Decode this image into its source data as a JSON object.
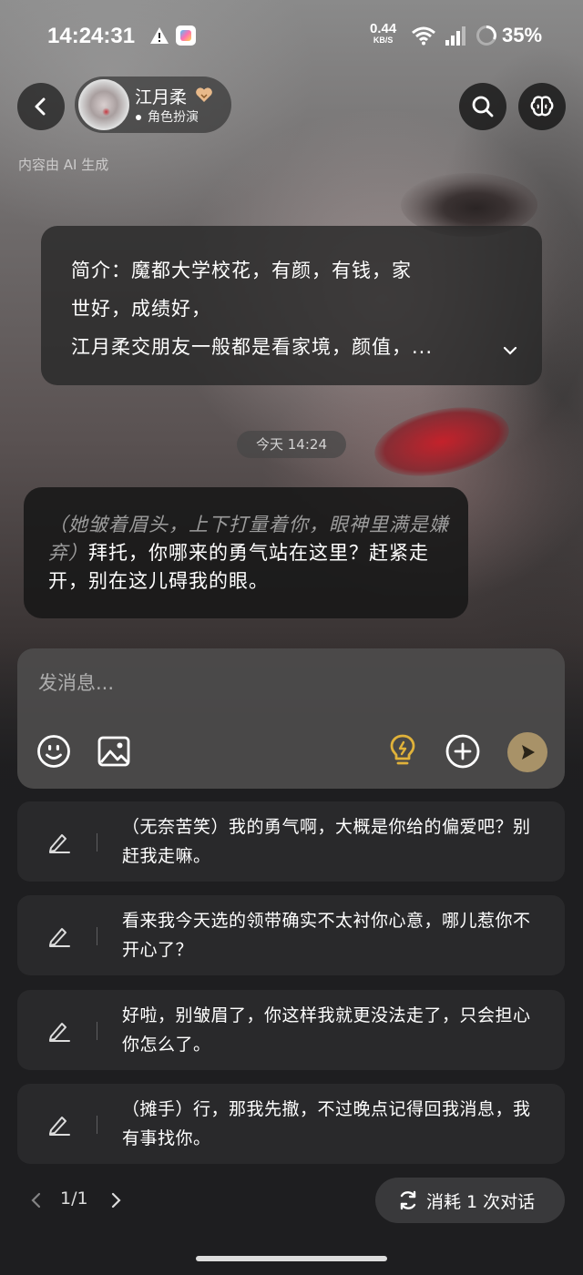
{
  "status_bar": {
    "time": "14:24:31",
    "net_speed_value": "0.44",
    "net_speed_unit": "KB/S",
    "battery": "35%",
    "icons": [
      "warning-icon",
      "app-notification-icon",
      "wifi-icon",
      "signal-icon",
      "battery-ring-icon"
    ]
  },
  "header": {
    "character_name": "江月柔",
    "role_label": "角色扮演",
    "ai_notice": "内容由 AI 生成",
    "icons": [
      "back-icon",
      "heart-badge-icon",
      "search-icon",
      "brain-icon"
    ]
  },
  "intro": {
    "lines": [
      "简介：魔都大学校花，有颜，有钱，家",
      "世好，成绩好，",
      "江月柔交朋友一般都是看家境，颜值，..."
    ]
  },
  "chat": {
    "time_label": "今天 14:24",
    "messages": [
      {
        "action": "（她皱着眉头，上下打量着你，眼神里满是嫌弃）",
        "text": "拜托，你哪来的勇气站在这里？赶紧走开，别在这儿碍我的眼。"
      }
    ]
  },
  "composer": {
    "placeholder": "发消息...",
    "icons": [
      "emoji-icon",
      "image-icon",
      "lightbulb-icon",
      "plus-icon",
      "send-icon"
    ],
    "accent_color": "#a89268",
    "idea_color": "#e0b23a"
  },
  "suggestions": [
    {
      "text": "（无奈苦笑）我的勇气啊，大概是你给的偏爱吧？别赶我走嘛。"
    },
    {
      "text": "看来我今天选的领带确实不太衬你心意，哪儿惹你不开心了？"
    },
    {
      "text": "好啦，别皱眉了，你这样我就更没法走了，只会担心你怎么了。"
    },
    {
      "text": "（摊手）行，那我先撤，不过晚点记得回我消息，我有事找你。"
    }
  ],
  "footer": {
    "page": "1/1",
    "consume_label": "消耗 1 次对话"
  }
}
